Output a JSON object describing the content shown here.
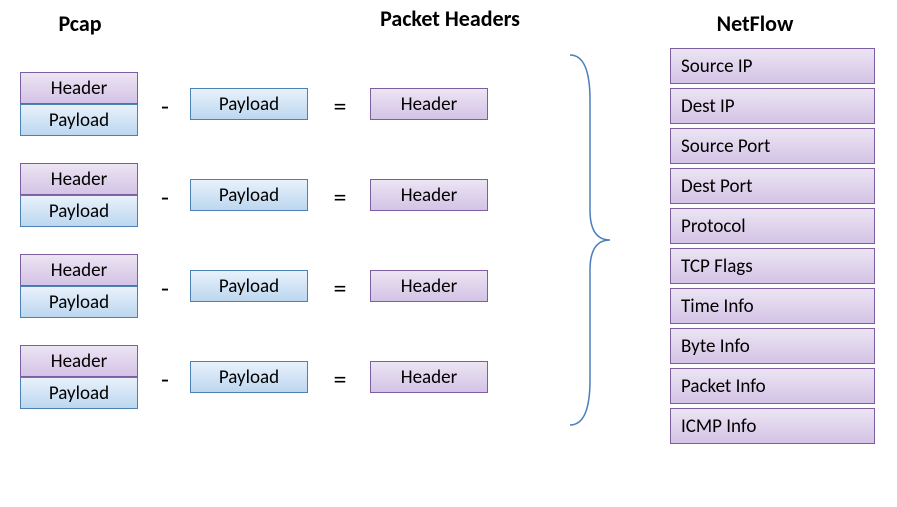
{
  "titles": {
    "pcap": "Pcap",
    "packet_headers": "Packet Headers",
    "netflow": "NetFlow"
  },
  "ops": {
    "minus": "-",
    "equals": "="
  },
  "labels": {
    "header": "Header",
    "payload": "Payload"
  },
  "pcap_rows": [
    {
      "header": "Header",
      "payload": "Payload"
    },
    {
      "header": "Header",
      "payload": "Payload"
    },
    {
      "header": "Header",
      "payload": "Payload"
    },
    {
      "header": "Header",
      "payload": "Payload"
    }
  ],
  "netflow_fields": [
    "Source IP",
    "Dest IP",
    "Source Port",
    "Dest Port",
    "Protocol",
    "TCP Flags",
    "Time Info",
    "Byte Info",
    "Packet Info",
    "ICMP Info"
  ]
}
